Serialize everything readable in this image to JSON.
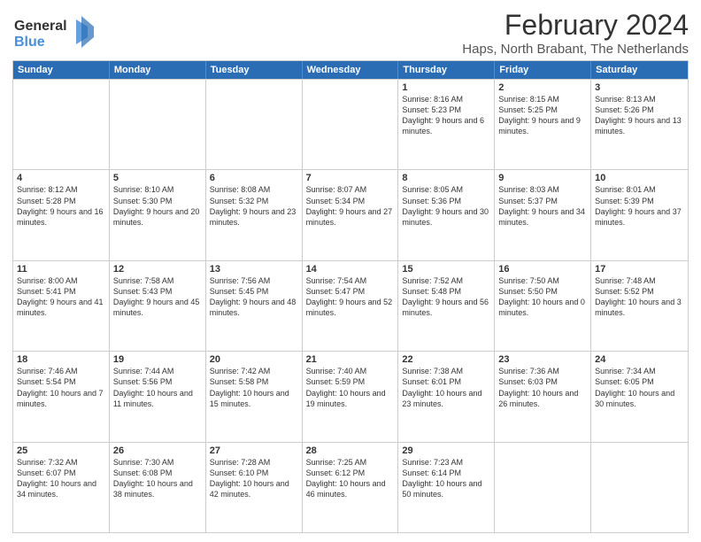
{
  "logo": {
    "line1": "General",
    "line2": "Blue"
  },
  "title": "February 2024",
  "subtitle": "Haps, North Brabant, The Netherlands",
  "header_days": [
    "Sunday",
    "Monday",
    "Tuesday",
    "Wednesday",
    "Thursday",
    "Friday",
    "Saturday"
  ],
  "weeks": [
    [
      {
        "day": "",
        "sunrise": "",
        "sunset": "",
        "daylight": ""
      },
      {
        "day": "",
        "sunrise": "",
        "sunset": "",
        "daylight": ""
      },
      {
        "day": "",
        "sunrise": "",
        "sunset": "",
        "daylight": ""
      },
      {
        "day": "",
        "sunrise": "",
        "sunset": "",
        "daylight": ""
      },
      {
        "day": "1",
        "sunrise": "Sunrise: 8:16 AM",
        "sunset": "Sunset: 5:23 PM",
        "daylight": "Daylight: 9 hours and 6 minutes."
      },
      {
        "day": "2",
        "sunrise": "Sunrise: 8:15 AM",
        "sunset": "Sunset: 5:25 PM",
        "daylight": "Daylight: 9 hours and 9 minutes."
      },
      {
        "day": "3",
        "sunrise": "Sunrise: 8:13 AM",
        "sunset": "Sunset: 5:26 PM",
        "daylight": "Daylight: 9 hours and 13 minutes."
      }
    ],
    [
      {
        "day": "4",
        "sunrise": "Sunrise: 8:12 AM",
        "sunset": "Sunset: 5:28 PM",
        "daylight": "Daylight: 9 hours and 16 minutes."
      },
      {
        "day": "5",
        "sunrise": "Sunrise: 8:10 AM",
        "sunset": "Sunset: 5:30 PM",
        "daylight": "Daylight: 9 hours and 20 minutes."
      },
      {
        "day": "6",
        "sunrise": "Sunrise: 8:08 AM",
        "sunset": "Sunset: 5:32 PM",
        "daylight": "Daylight: 9 hours and 23 minutes."
      },
      {
        "day": "7",
        "sunrise": "Sunrise: 8:07 AM",
        "sunset": "Sunset: 5:34 PM",
        "daylight": "Daylight: 9 hours and 27 minutes."
      },
      {
        "day": "8",
        "sunrise": "Sunrise: 8:05 AM",
        "sunset": "Sunset: 5:36 PM",
        "daylight": "Daylight: 9 hours and 30 minutes."
      },
      {
        "day": "9",
        "sunrise": "Sunrise: 8:03 AM",
        "sunset": "Sunset: 5:37 PM",
        "daylight": "Daylight: 9 hours and 34 minutes."
      },
      {
        "day": "10",
        "sunrise": "Sunrise: 8:01 AM",
        "sunset": "Sunset: 5:39 PM",
        "daylight": "Daylight: 9 hours and 37 minutes."
      }
    ],
    [
      {
        "day": "11",
        "sunrise": "Sunrise: 8:00 AM",
        "sunset": "Sunset: 5:41 PM",
        "daylight": "Daylight: 9 hours and 41 minutes."
      },
      {
        "day": "12",
        "sunrise": "Sunrise: 7:58 AM",
        "sunset": "Sunset: 5:43 PM",
        "daylight": "Daylight: 9 hours and 45 minutes."
      },
      {
        "day": "13",
        "sunrise": "Sunrise: 7:56 AM",
        "sunset": "Sunset: 5:45 PM",
        "daylight": "Daylight: 9 hours and 48 minutes."
      },
      {
        "day": "14",
        "sunrise": "Sunrise: 7:54 AM",
        "sunset": "Sunset: 5:47 PM",
        "daylight": "Daylight: 9 hours and 52 minutes."
      },
      {
        "day": "15",
        "sunrise": "Sunrise: 7:52 AM",
        "sunset": "Sunset: 5:48 PM",
        "daylight": "Daylight: 9 hours and 56 minutes."
      },
      {
        "day": "16",
        "sunrise": "Sunrise: 7:50 AM",
        "sunset": "Sunset: 5:50 PM",
        "daylight": "Daylight: 10 hours and 0 minutes."
      },
      {
        "day": "17",
        "sunrise": "Sunrise: 7:48 AM",
        "sunset": "Sunset: 5:52 PM",
        "daylight": "Daylight: 10 hours and 3 minutes."
      }
    ],
    [
      {
        "day": "18",
        "sunrise": "Sunrise: 7:46 AM",
        "sunset": "Sunset: 5:54 PM",
        "daylight": "Daylight: 10 hours and 7 minutes."
      },
      {
        "day": "19",
        "sunrise": "Sunrise: 7:44 AM",
        "sunset": "Sunset: 5:56 PM",
        "daylight": "Daylight: 10 hours and 11 minutes."
      },
      {
        "day": "20",
        "sunrise": "Sunrise: 7:42 AM",
        "sunset": "Sunset: 5:58 PM",
        "daylight": "Daylight: 10 hours and 15 minutes."
      },
      {
        "day": "21",
        "sunrise": "Sunrise: 7:40 AM",
        "sunset": "Sunset: 5:59 PM",
        "daylight": "Daylight: 10 hours and 19 minutes."
      },
      {
        "day": "22",
        "sunrise": "Sunrise: 7:38 AM",
        "sunset": "Sunset: 6:01 PM",
        "daylight": "Daylight: 10 hours and 23 minutes."
      },
      {
        "day": "23",
        "sunrise": "Sunrise: 7:36 AM",
        "sunset": "Sunset: 6:03 PM",
        "daylight": "Daylight: 10 hours and 26 minutes."
      },
      {
        "day": "24",
        "sunrise": "Sunrise: 7:34 AM",
        "sunset": "Sunset: 6:05 PM",
        "daylight": "Daylight: 10 hours and 30 minutes."
      }
    ],
    [
      {
        "day": "25",
        "sunrise": "Sunrise: 7:32 AM",
        "sunset": "Sunset: 6:07 PM",
        "daylight": "Daylight: 10 hours and 34 minutes."
      },
      {
        "day": "26",
        "sunrise": "Sunrise: 7:30 AM",
        "sunset": "Sunset: 6:08 PM",
        "daylight": "Daylight: 10 hours and 38 minutes."
      },
      {
        "day": "27",
        "sunrise": "Sunrise: 7:28 AM",
        "sunset": "Sunset: 6:10 PM",
        "daylight": "Daylight: 10 hours and 42 minutes."
      },
      {
        "day": "28",
        "sunrise": "Sunrise: 7:25 AM",
        "sunset": "Sunset: 6:12 PM",
        "daylight": "Daylight: 10 hours and 46 minutes."
      },
      {
        "day": "29",
        "sunrise": "Sunrise: 7:23 AM",
        "sunset": "Sunset: 6:14 PM",
        "daylight": "Daylight: 10 hours and 50 minutes."
      },
      {
        "day": "",
        "sunrise": "",
        "sunset": "",
        "daylight": ""
      },
      {
        "day": "",
        "sunrise": "",
        "sunset": "",
        "daylight": ""
      }
    ]
  ]
}
